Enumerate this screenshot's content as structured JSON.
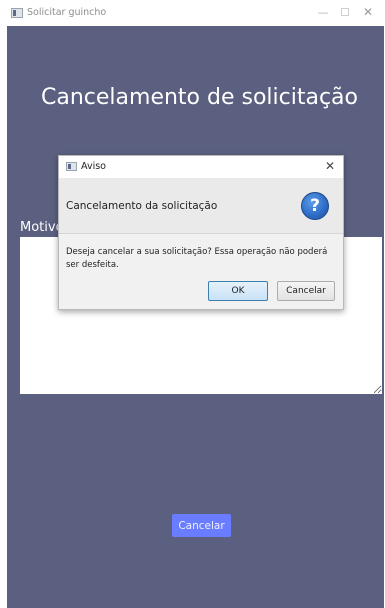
{
  "window": {
    "title": "Solicitar guincho",
    "minimize_glyph": "—",
    "close_glyph": "✕"
  },
  "main": {
    "heading": "Cancelamento de solicitação",
    "motivo_label": "Motivo",
    "cancel_button": "Cancelar"
  },
  "dialog": {
    "title": "Aviso",
    "close_glyph": "✕",
    "header": "Cancelamento da solicitação",
    "help_glyph": "?",
    "message": "Deseja cancelar a sua solicitação? Essa operação não poderá ser desfeita.",
    "ok_label": "OK",
    "cancel_label": "Cancelar"
  },
  "colors": {
    "background": "#5b6081",
    "primary_button": "#6a7cff"
  }
}
